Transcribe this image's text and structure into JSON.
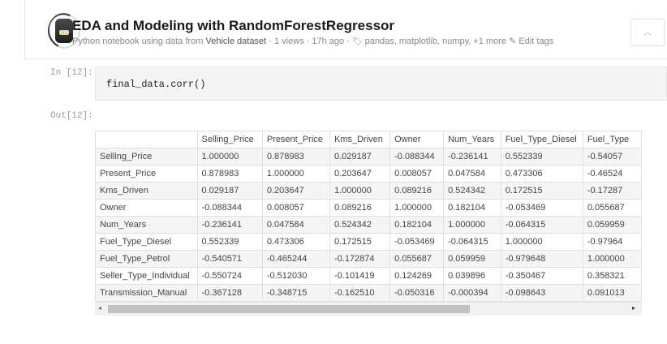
{
  "notebook": {
    "title": "EDA and Modeling with RandomForestRegressor",
    "meta_prefix": "Python notebook using data from ",
    "dataset": "Vehicle dataset",
    "meta_suffix": " · 1 views · 17h ago · ",
    "tags": "pandas, matplotlib, numpy, +1 more",
    "edit_tags": "Edit tags",
    "tag_icon": "tag-icon",
    "edit_icon": "pencil-icon",
    "collapse_icon": "chevron-up-icon"
  },
  "cell_in": {
    "prompt": "In [12]:",
    "code": "final_data.corr()"
  },
  "cell_out": {
    "prompt": "Out[12]:"
  },
  "table": {
    "columns": [
      "Selling_Price",
      "Present_Price",
      "Kms_Driven",
      "Owner",
      "Num_Years",
      "Fuel_Type_Diesel",
      "Fuel_Type"
    ],
    "rows": [
      {
        "label": "Selling_Price",
        "values": [
          "1.000000",
          "0.878983",
          "0.029187",
          "-0.088344",
          "-0.236141",
          "0.552339",
          "-0.54057"
        ]
      },
      {
        "label": "Present_Price",
        "values": [
          "0.878983",
          "1.000000",
          "0.203647",
          "0.008057",
          "0.047584",
          "0.473306",
          "-0.46524"
        ]
      },
      {
        "label": "Kms_Driven",
        "values": [
          "0.029187",
          "0.203647",
          "1.000000",
          "0.089216",
          "0.524342",
          "0.172515",
          "-0.17287"
        ]
      },
      {
        "label": "Owner",
        "values": [
          "-0.088344",
          "0.008057",
          "0.089216",
          "1.000000",
          "0.182104",
          "-0.053469",
          "0.055687"
        ]
      },
      {
        "label": "Num_Years",
        "values": [
          "-0.236141",
          "0.047584",
          "0.524342",
          "0.182104",
          "1.000000",
          "-0.064315",
          "0.059959"
        ]
      },
      {
        "label": "Fuel_Type_Diesel",
        "values": [
          "0.552339",
          "0.473306",
          "0.172515",
          "-0.053469",
          "-0.064315",
          "1.000000",
          "-0.97964"
        ]
      },
      {
        "label": "Fuel_Type_Petrol",
        "values": [
          "-0.540571",
          "-0.465244",
          "-0.172874",
          "0.055687",
          "0.059959",
          "-0.979648",
          "1.000000"
        ]
      },
      {
        "label": "Seller_Type_Individual",
        "values": [
          "-0.550724",
          "-0.512030",
          "-0.101419",
          "0.124269",
          "0.039896",
          "-0.350467",
          "0.358321"
        ]
      },
      {
        "label": "Transmission_Manual",
        "values": [
          "-0.367128",
          "-0.348715",
          "-0.162510",
          "-0.050316",
          "-0.000394",
          "-0.098643",
          "0.091013"
        ]
      }
    ]
  },
  "scrollbar": {
    "left_arrow": "◂",
    "right_arrow": "▸"
  }
}
